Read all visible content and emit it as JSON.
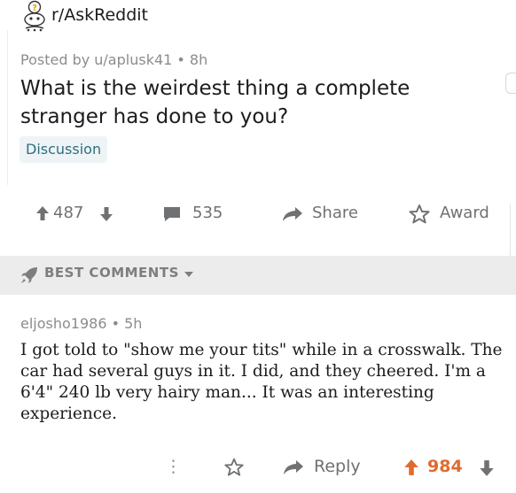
{
  "header": {
    "subreddit": "r/AskReddit",
    "subreddit_icon": "reddit-snoo-question-icon"
  },
  "post": {
    "meta": "Posted by u/aplusk41 • 8h",
    "title": "What is the weirdest thing a complete stranger has done to you?",
    "flair": "Discussion",
    "upvotes": "487",
    "comments": "535",
    "share_label": "Share",
    "award_label": "Award"
  },
  "sort": {
    "label": "BEST COMMENTS"
  },
  "comment": {
    "meta": "eljosho1986 • 5h",
    "body": "I got told to \"show me your tits\" while in a crosswalk. The car had several guys in it. I did, and they cheered. I'm a 6'4\" 240 lb very hairy man... It was an interesting experience.",
    "more_label": "⋮",
    "reply_label": "Reply",
    "score": "984"
  },
  "colors": {
    "upvote_active": "#e06b2e",
    "muted": "#6f7173",
    "flair_text": "#2f6f80",
    "bar_bg": "#ececec"
  }
}
